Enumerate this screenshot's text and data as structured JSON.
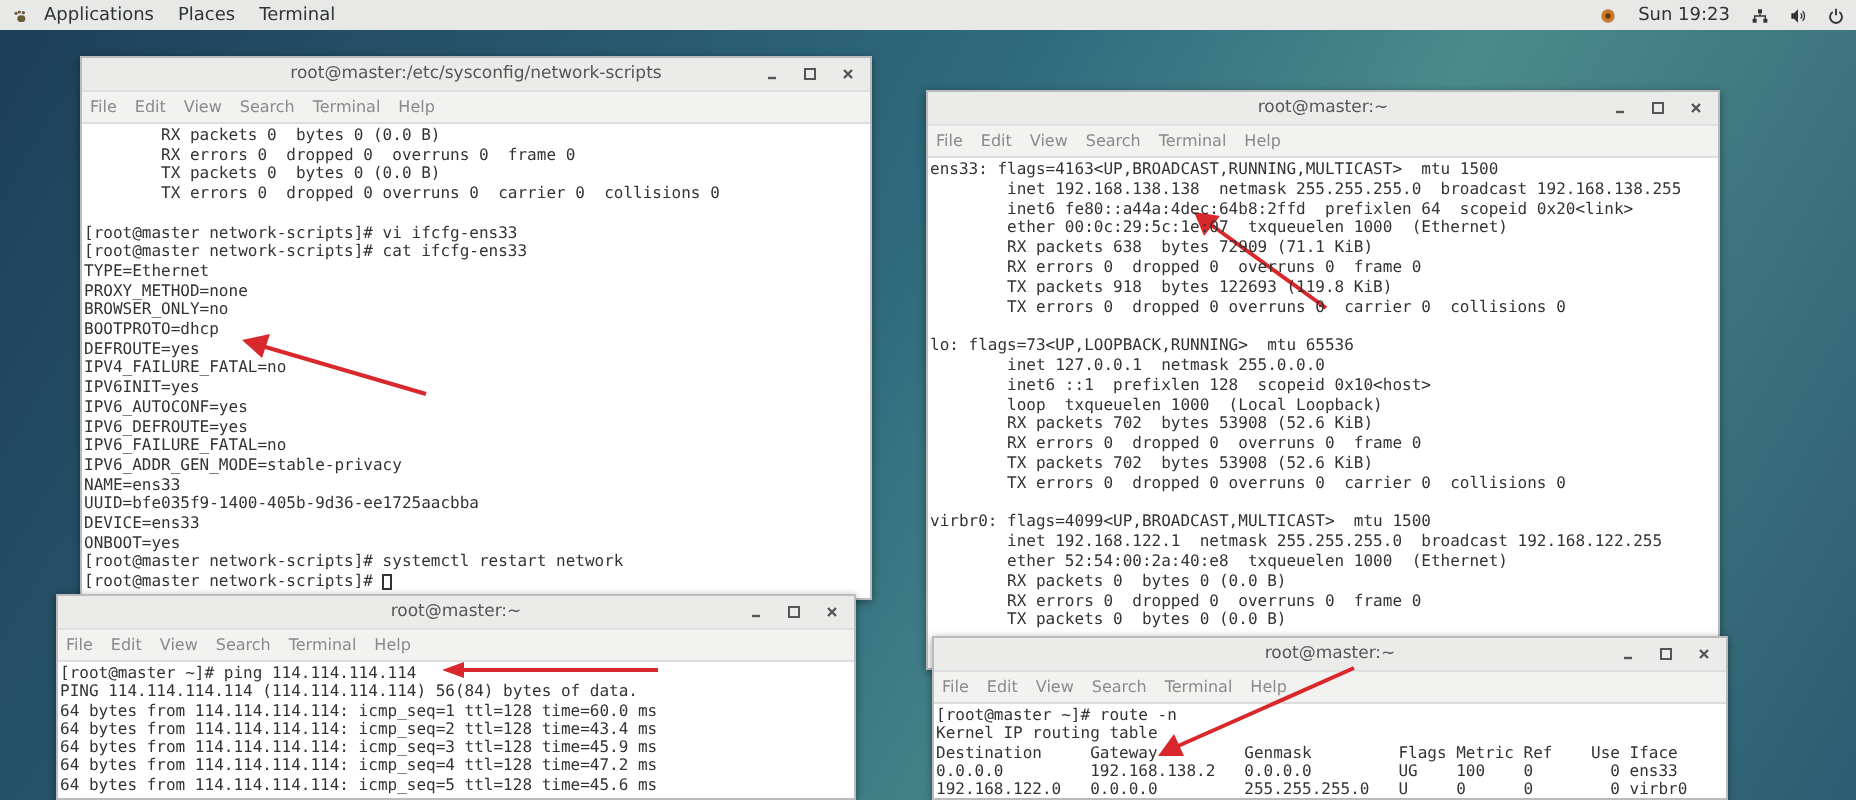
{
  "top_bar": {
    "menus": [
      "Applications",
      "Places",
      "Terminal"
    ],
    "clock": "Sun 19:23"
  },
  "windows": [
    {
      "title": "root@master:/etc/sysconfig/network-scripts",
      "menu": [
        "File",
        "Edit",
        "View",
        "Search",
        "Terminal",
        "Help"
      ],
      "cursor": true,
      "blocks": [
        [
          "        RX packets 0  bytes 0 (0.0 B)",
          "        RX errors 0  dropped 0  overruns 0  frame 0",
          "        TX packets 0  bytes 0 (0.0 B)",
          "        TX errors 0  dropped 0 overruns 0  carrier 0  collisions 0"
        ],
        [
          "[root@master network-scripts]# vi ifcfg-ens33",
          "[root@master network-scripts]# cat ifcfg-ens33",
          "TYPE=Ethernet",
          "PROXY_METHOD=none",
          "BROWSER_ONLY=no",
          "BOOTPROTO=dhcp",
          "DEFROUTE=yes",
          "IPV4_FAILURE_FATAL=no",
          "IPV6INIT=yes",
          "IPV6_AUTOCONF=yes",
          "IPV6_DEFROUTE=yes",
          "IPV6_FAILURE_FATAL=no",
          "IPV6_ADDR_GEN_MODE=stable-privacy",
          "NAME=ens33",
          "UUID=bfe035f9-1400-405b-9d36-ee1725aacbba",
          "DEVICE=ens33",
          "ONBOOT=yes",
          "[root@master network-scripts]# systemctl restart network",
          "[root@master network-scripts]# "
        ]
      ]
    },
    {
      "title": "root@master:~",
      "menu": [
        "File",
        "Edit",
        "View",
        "Search",
        "Terminal",
        "Help"
      ],
      "cursor": false,
      "blocks": [
        [
          "ens33: flags=4163<UP,BROADCAST,RUNNING,MULTICAST>  mtu 1500",
          "        inet 192.168.138.138  netmask 255.255.255.0  broadcast 192.168.138.255",
          "        inet6 fe80::a44a:4dec:64b8:2ffd  prefixlen 64  scopeid 0x20<link>",
          "        ether 00:0c:29:5c:1e:07  txqueuelen 1000  (Ethernet)",
          "        RX packets 638  bytes 72909 (71.1 KiB)",
          "        RX errors 0  dropped 0  overruns 0  frame 0",
          "        TX packets 918  bytes 122693 (119.8 KiB)",
          "        TX errors 0  dropped 0 overruns 0  carrier 0  collisions 0"
        ],
        [
          "lo: flags=73<UP,LOOPBACK,RUNNING>  mtu 65536",
          "        inet 127.0.0.1  netmask 255.0.0.0",
          "        inet6 ::1  prefixlen 128  scopeid 0x10<host>",
          "        loop  txqueuelen 1000  (Local Loopback)",
          "        RX packets 702  bytes 53908 (52.6 KiB)",
          "        RX errors 0  dropped 0  overruns 0  frame 0",
          "        TX packets 702  bytes 53908 (52.6 KiB)",
          "        TX errors 0  dropped 0 overruns 0  carrier 0  collisions 0"
        ],
        [
          "virbr0: flags=4099<UP,BROADCAST,MULTICAST>  mtu 1500",
          "        inet 192.168.122.1  netmask 255.255.255.0  broadcast 192.168.122.255",
          "        ether 52:54:00:2a:40:e8  txqueuelen 1000  (Ethernet)",
          "        RX packets 0  bytes 0 (0.0 B)",
          "        RX errors 0  dropped 0  overruns 0  frame 0",
          "        TX packets 0  bytes 0 (0.0 B)"
        ]
      ]
    },
    {
      "title": "root@master:~",
      "menu": [
        "File",
        "Edit",
        "View",
        "Search",
        "Terminal",
        "Help"
      ],
      "cursor": false,
      "blocks": [
        [
          "[root@master ~]# ping 114.114.114.114",
          "PING 114.114.114.114 (114.114.114.114) 56(84) bytes of data.",
          "64 bytes from 114.114.114.114: icmp_seq=1 ttl=128 time=60.0 ms",
          "64 bytes from 114.114.114.114: icmp_seq=2 ttl=128 time=43.4 ms",
          "64 bytes from 114.114.114.114: icmp_seq=3 ttl=128 time=45.9 ms",
          "64 bytes from 114.114.114.114: icmp_seq=4 ttl=128 time=47.2 ms",
          "64 bytes from 114.114.114.114: icmp_seq=5 ttl=128 time=45.6 ms"
        ]
      ]
    },
    {
      "title": "root@master:~",
      "menu": [
        "File",
        "Edit",
        "View",
        "Search",
        "Terminal",
        "Help"
      ],
      "cursor": false,
      "blocks": [
        [
          "[root@master ~]# route -n",
          "Kernel IP routing table",
          "Destination     Gateway         Genmask         Flags Metric Ref    Use Iface",
          "0.0.0.0         192.168.138.2   0.0.0.0         UG    100    0        0 ens33",
          "192.168.122.0   0.0.0.0         255.255.255.0   U     0      0        0 virbr0"
        ]
      ]
    }
  ]
}
